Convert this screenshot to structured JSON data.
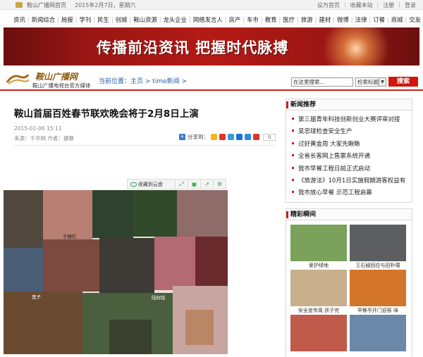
{
  "topbar": {
    "home_link": "鞍山广播网首页",
    "date": "2015年2月7日，星期六",
    "right_links": [
      "设为首页",
      "收藏本站",
      "注册",
      "登录"
    ]
  },
  "channel_nav": [
    "资讯",
    "新闻综合",
    "局报",
    "学刊",
    "民生",
    "创城",
    "鞍山资源",
    "龙头企业",
    "网络发言人",
    "房产",
    "车市",
    "教育",
    "医疗",
    "旅游",
    "建材",
    "微博",
    "法律",
    "订餐",
    "商城",
    "交友"
  ],
  "banner": {
    "slogan": "传播前沿资讯  把握时代脉搏"
  },
  "logo": {
    "title": "鞍山广播网",
    "subtitle": "鞍山广播电视台官方媒体"
  },
  "breadcrumb": {
    "label": "当前位置：",
    "home": "主页",
    "sep1": " > ",
    "section": "time新闻",
    "sep2": " >"
  },
  "search": {
    "placeholder": "在这里搜索...",
    "value": "在这里搜索...",
    "scope": "检索标题",
    "button": "搜索"
  },
  "article": {
    "title": "鞍山首届百姓春节联欢晚会将于2月8日上演",
    "datetime": "2015-02-06 15:11",
    "meta": "来源：千华网 作者：摄赛",
    "share_label": "分享到：",
    "share_count": "0"
  },
  "cloud_toolbar": {
    "save_label": "收藏到云盘"
  },
  "collage": {
    "captions": [
      "于丽红",
      "黑子",
      "陆树铭"
    ],
    "colors": {
      "bg": "#e8e3dc",
      "p1": "#51493f",
      "p2": "#b87f73",
      "p3": "#2f4230",
      "p4": "#314b2a",
      "p5": "#8f6b69",
      "p6": "#7c4a3e",
      "p7": "#4a5e78",
      "p8": "#3e3a36",
      "p9": "#b36a74",
      "p10": "#6b2a2e",
      "p11": "#6a4b32",
      "p12": "#4a5f3d",
      "p13": "#c9a5a1",
      "p14": "#2b2622",
      "p15": "#b7815c"
    }
  },
  "news_recommend": {
    "heading": "新闻推荐",
    "items": [
      "第三届青年科技创新创业大赛评审对接",
      "吴忠球检查安全生产",
      "过好黄金周 大家先瞅瞅",
      "全省长客网上售票系统开通",
      "我市早餐工程日前正式启动",
      "《旅游法》10月1日实施假期游客权益有",
      "我市放心早餐 示范工程启幕"
    ]
  },
  "highlights": {
    "heading": "精彩瞬间",
    "items": [
      {
        "label": "爱护绿地",
        "color": "#7aa25a"
      },
      {
        "label": "王石疑回应与田朴珺",
        "color": "#5c5e62"
      },
      {
        "label": "安全宣传周 孩子完",
        "color": "#c8b08e"
      },
      {
        "label": "早餐亭开门迎客 味",
        "color": "#d4762a"
      },
      {
        "label": "",
        "color": "#c05a4a"
      },
      {
        "label": "",
        "color": "#6c88a8"
      }
    ]
  }
}
